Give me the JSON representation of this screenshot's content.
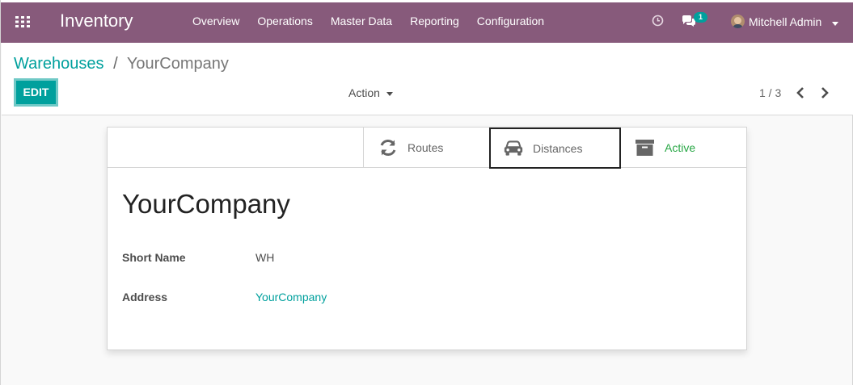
{
  "navbar": {
    "app_name": "Inventory",
    "menu": [
      "Overview",
      "Operations",
      "Master Data",
      "Reporting",
      "Configuration"
    ],
    "chat_count": "1",
    "user": "Mitchell Admin",
    "icons": [
      "apps-grid-icon",
      "clock-icon",
      "chat-icon",
      "avatar"
    ]
  },
  "breadcrumb": {
    "parent": "Warehouses",
    "separator": "/",
    "current": "YourCompany"
  },
  "control": {
    "edit_label": "EDIT",
    "action_label": "Action",
    "pager": "1 / 3"
  },
  "button_box": {
    "routes": "Routes",
    "distances": "Distances",
    "active": "Active"
  },
  "form": {
    "title": "YourCompany",
    "short_name_label": "Short Name",
    "short_name_value": "WH",
    "address_label": "Address",
    "address_value": "YourCompany"
  },
  "colors": {
    "navbar": "#875a7b",
    "accent": "#00a09d",
    "active": "#28a745"
  }
}
